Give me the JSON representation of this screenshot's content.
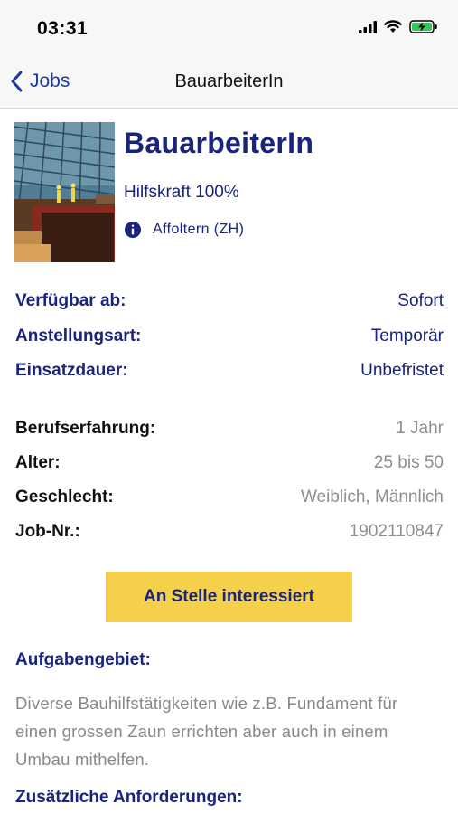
{
  "status_bar": {
    "time": "03:31"
  },
  "nav": {
    "back_label": "Jobs",
    "title": "BauarbeiterIn"
  },
  "job": {
    "title": "BauarbeiterIn",
    "subtitle": "Hilfskraft 100%",
    "location": "Affoltern (ZH)"
  },
  "details_primary": [
    {
      "label": "Verfügbar ab:",
      "value": "Sofort"
    },
    {
      "label": "Anstellungsart:",
      "value": "Temporär"
    },
    {
      "label": "Einsatzdauer:",
      "value": "Unbefristet"
    }
  ],
  "details_secondary": [
    {
      "label": "Berufserfahrung:",
      "value": "1 Jahr"
    },
    {
      "label": "Alter:",
      "value": "25 bis 50"
    },
    {
      "label": "Geschlecht:",
      "value": "Weiblich, Männlich"
    },
    {
      "label": "Job-Nr.:",
      "value": "1902110847"
    }
  ],
  "cta_label": "An Stelle interessiert",
  "sections": {
    "aufgabengebiet_title": "Aufgabengebiet:",
    "aufgabengebiet_text": "Diverse Bauhilfstätigkeiten wie z.B. Fundament für einen grossen Zaun errichten aber auch in einem Umbau mithelfen.",
    "anforderungen_title": "Zusätzliche Anforderungen:"
  },
  "colors": {
    "accent": "#1a237e",
    "link": "#1a3aa0",
    "button": "#f5d04a",
    "muted": "#8e8e8e"
  },
  "icons": {
    "back": "chevron-left-icon",
    "location": "info-circle-icon",
    "signal": "signal-icon",
    "wifi": "wifi-icon",
    "battery": "battery-charging-icon"
  }
}
